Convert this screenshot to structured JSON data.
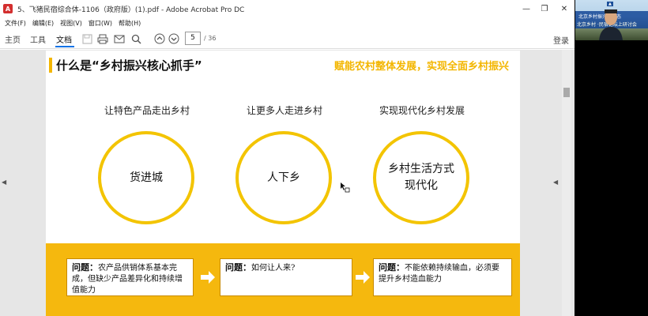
{
  "window": {
    "title": "5、飞猪民宿综合体-1106（政府版）(1).pdf - Adobe Acrobat Pro DC",
    "minimize_glyph": "—",
    "restore_glyph": "❐",
    "close_glyph": "✕"
  },
  "menu": [
    "文件(F)",
    "编辑(E)",
    "视图(V)",
    "窗口(W)",
    "帮助(H)"
  ],
  "toolbar": {
    "tabs": [
      "主页",
      "工具",
      "文档"
    ],
    "page_current": "5",
    "page_total": "/ 36",
    "login": "登录"
  },
  "slide": {
    "title": "什么是“乡村振兴核心抓手”",
    "slogan": "赋能农村整体发展，实现全面乡村振兴",
    "columns": [
      {
        "label": "让特色产品走出乡村",
        "circle": "货进城"
      },
      {
        "label": "让更多人走进乡村",
        "circle": "人下乡"
      },
      {
        "label": "实现现代化乡村发展",
        "circle": "乡村生活方式\n现代化"
      }
    ],
    "problems": [
      {
        "label": "问题：",
        "text": "农产品供销体系基本完成，但缺少产品差异化和持续增值能力"
      },
      {
        "label": "问题：",
        "text": "如何让人来?"
      },
      {
        "label": "问题：",
        "text": "不能依赖持续输血，必须要提升乡村造血能力"
      }
    ]
  },
  "video": {
    "banner_line1": "北京乡村振兴新业态",
    "banner_line2": "北京乡村 ·民宿论坛上研讨会"
  },
  "colors": {
    "accent_yellow": "#f3b600",
    "band_yellow": "#f5b80e",
    "acrobat_red": "#d32f2f",
    "tab_blue": "#1473e6"
  }
}
